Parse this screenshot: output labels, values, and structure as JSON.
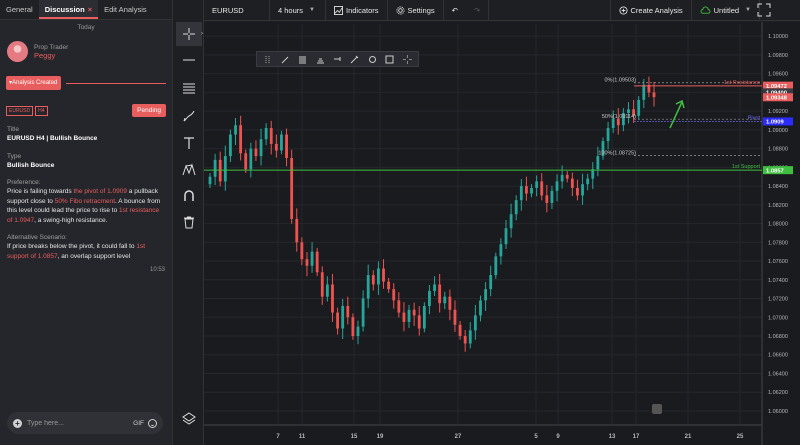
{
  "left_panel": {
    "tabs": [
      {
        "label": "General"
      },
      {
        "label": "Discussion",
        "close": "×"
      },
      {
        "label": "Edit Analysis"
      }
    ],
    "day_label": "Today",
    "trader": {
      "role": "Prop Trader",
      "name": "Peggy"
    },
    "created_label": "Analysis Created",
    "symbol_badge": "EURUSD",
    "tf_badge": "H4",
    "status": "Pending",
    "title_label": "Title",
    "title": "EURUSD H4 | Bullish Bounce",
    "type_label": "Type",
    "type": "Bullish Bounce",
    "pref_label": "Preference:",
    "pref_parts": [
      "Price is failing towards ",
      "the pivot of 1.0909",
      " a pullback support close to ",
      "50% Fibo retracment",
      ". A bounce from this level could lead the price to rise to ",
      "1st resistance of 1.0947",
      ", a swing-high resistance."
    ],
    "alt_label": "Alternative Scenario:",
    "alt_parts": [
      "If price breaks below the pivot, it could fall to ",
      "1st support of 1.0857",
      ", an overlap support level"
    ],
    "time": "10:53",
    "input_placeholder": "Type here...",
    "gif_label": "GIF"
  },
  "topbar": {
    "symbol": "EURUSD",
    "timeframe": "4 hours",
    "indicators_label": "Indicators",
    "settings_label": "Settings",
    "create_label": "Create Analysis",
    "layout_label": "Untitled"
  },
  "icons": {
    "crosshair": "crosshair-icon",
    "line": "line-icon",
    "fib": "fib-icon",
    "brush": "brush-icon",
    "text": "text-icon",
    "pattern": "pattern-icon",
    "magnet": "magnet-icon",
    "trash": "trash-icon",
    "layers": "layers-icon"
  },
  "colors": {
    "accent": "#e85d5d",
    "up": "#26a69a",
    "down": "#ef5350",
    "support": "#3fbf3f",
    "pivot": "#6f6fff"
  },
  "chart_data": {
    "type": "candlestick",
    "x_tick_labels": [
      "7",
      "11",
      "15",
      "19",
      "27",
      "5",
      "9",
      "13",
      "17",
      "21",
      "25"
    ],
    "y_tick_labels": [
      "1.10000",
      "1.09800",
      "1.09600",
      "1.09400",
      "1.09200",
      "1.09000",
      "1.08800",
      "1.08600",
      "1.08400",
      "1.08200",
      "1.08000",
      "1.07800",
      "1.07600",
      "1.07400",
      "1.07200",
      "1.07000",
      "1.06800",
      "1.06600",
      "1.06400",
      "1.06200",
      "1.06000"
    ],
    "y_ticks": [
      1.1,
      1.098,
      1.096,
      1.094,
      1.092,
      1.09,
      1.088,
      1.086,
      1.084,
      1.082,
      1.08,
      1.078,
      1.076,
      1.074,
      1.072,
      1.07,
      1.068,
      1.066,
      1.064,
      1.062,
      1.06
    ],
    "ylim": [
      1.0585,
      1.1013
    ],
    "price_tags": [
      {
        "text": "1.09472",
        "value": 1.09472,
        "color": "#e85d5d"
      },
      {
        "text": "1.09400",
        "value": 1.094,
        "color": "#3a3a40"
      },
      {
        "text": "1.09348",
        "value": 1.09348,
        "color": "#e85d5d"
      },
      {
        "text": "1.0909",
        "value": 1.0909,
        "color": "#2c2cff"
      },
      {
        "text": "1.0857",
        "value": 1.0857,
        "color": "#3fbf3f"
      }
    ],
    "levels": [
      {
        "label": "1st Resistance",
        "value": 1.0947,
        "color": "#e85d5d"
      },
      {
        "label": "Pivot",
        "value": 1.0909,
        "color": "#6f6fff"
      },
      {
        "label": "1st Support",
        "value": 1.0857,
        "color": "#3fbf3f"
      }
    ],
    "fib_levels": [
      {
        "label": "0%(1.09503)",
        "value": 1.09503
      },
      {
        "label": "50%(1.09114)",
        "value": 1.09114
      },
      {
        "label": "100%(1.08725)",
        "value": 1.08725
      }
    ],
    "closes": [
      1.085,
      1.0868,
      1.0845,
      1.0872,
      1.0895,
      1.0905,
      1.0875,
      1.0858,
      1.088,
      1.0872,
      1.089,
      1.0902,
      1.0885,
      1.0878,
      1.0895,
      1.087,
      1.0805,
      1.078,
      1.0762,
      1.0755,
      1.077,
      1.0748,
      1.0722,
      1.0735,
      1.0705,
      1.0688,
      1.0712,
      1.07,
      1.068,
      1.069,
      1.072,
      1.0745,
      1.0735,
      1.0752,
      1.0738,
      1.073,
      1.0718,
      1.0705,
      1.0695,
      1.0708,
      1.0702,
      1.0688,
      1.0712,
      1.0728,
      1.0735,
      1.0715,
      1.0722,
      1.0708,
      1.0692,
      1.068,
      1.0672,
      1.0686,
      1.0702,
      1.0718,
      1.073,
      1.0745,
      1.0765,
      1.0778,
      1.0795,
      1.081,
      1.0825,
      1.084,
      1.0832,
      1.0838,
      1.0845,
      1.083,
      1.0822,
      1.0835,
      1.0845,
      1.0852,
      1.0848,
      1.0838,
      1.083,
      1.0842,
      1.0848,
      1.0858,
      1.0872,
      1.0888,
      1.0902,
      1.0912,
      1.0905,
      1.0918,
      1.0922,
      1.0915,
      1.0932,
      1.0948,
      1.094,
      1.0935
    ]
  }
}
